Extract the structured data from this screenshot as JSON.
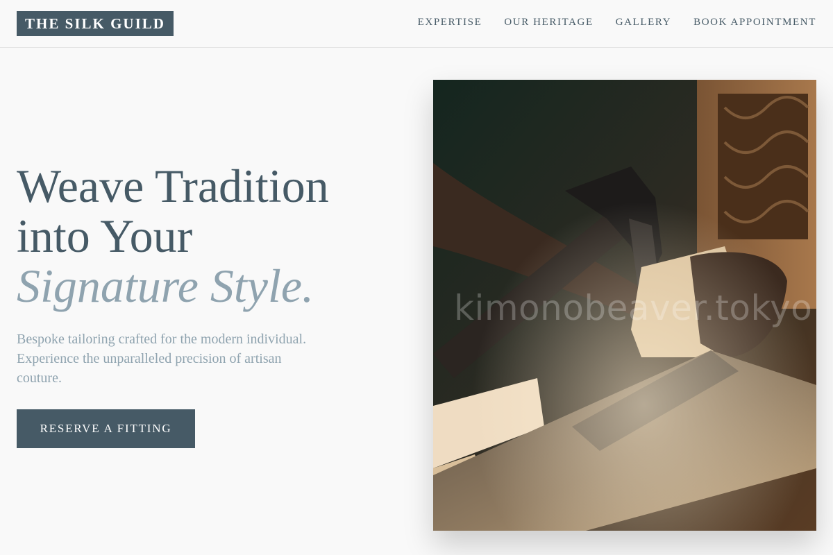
{
  "brand": {
    "name": "THE SILK GUILD"
  },
  "nav": {
    "items": [
      {
        "label": "EXPERTISE"
      },
      {
        "label": "OUR HERITAGE"
      },
      {
        "label": "GALLERY"
      },
      {
        "label": "BOOK APPOINTMENT"
      }
    ]
  },
  "hero": {
    "title_line1": "Weave Tradition",
    "title_line2": "into Your",
    "title_accent": "Signature Style.",
    "subtitle": "Bespoke tailoring crafted for the modern individual. Experience the unparalleled precision of artisan couture.",
    "cta_label": "RESERVE A FITTING"
  },
  "image": {
    "description_icon": "woodcarving-photo",
    "watermark": "kimonobeaver.tokyo"
  },
  "colors": {
    "primary": "#465a66",
    "accent": "#8fa3af",
    "background": "#f9f9f9"
  }
}
